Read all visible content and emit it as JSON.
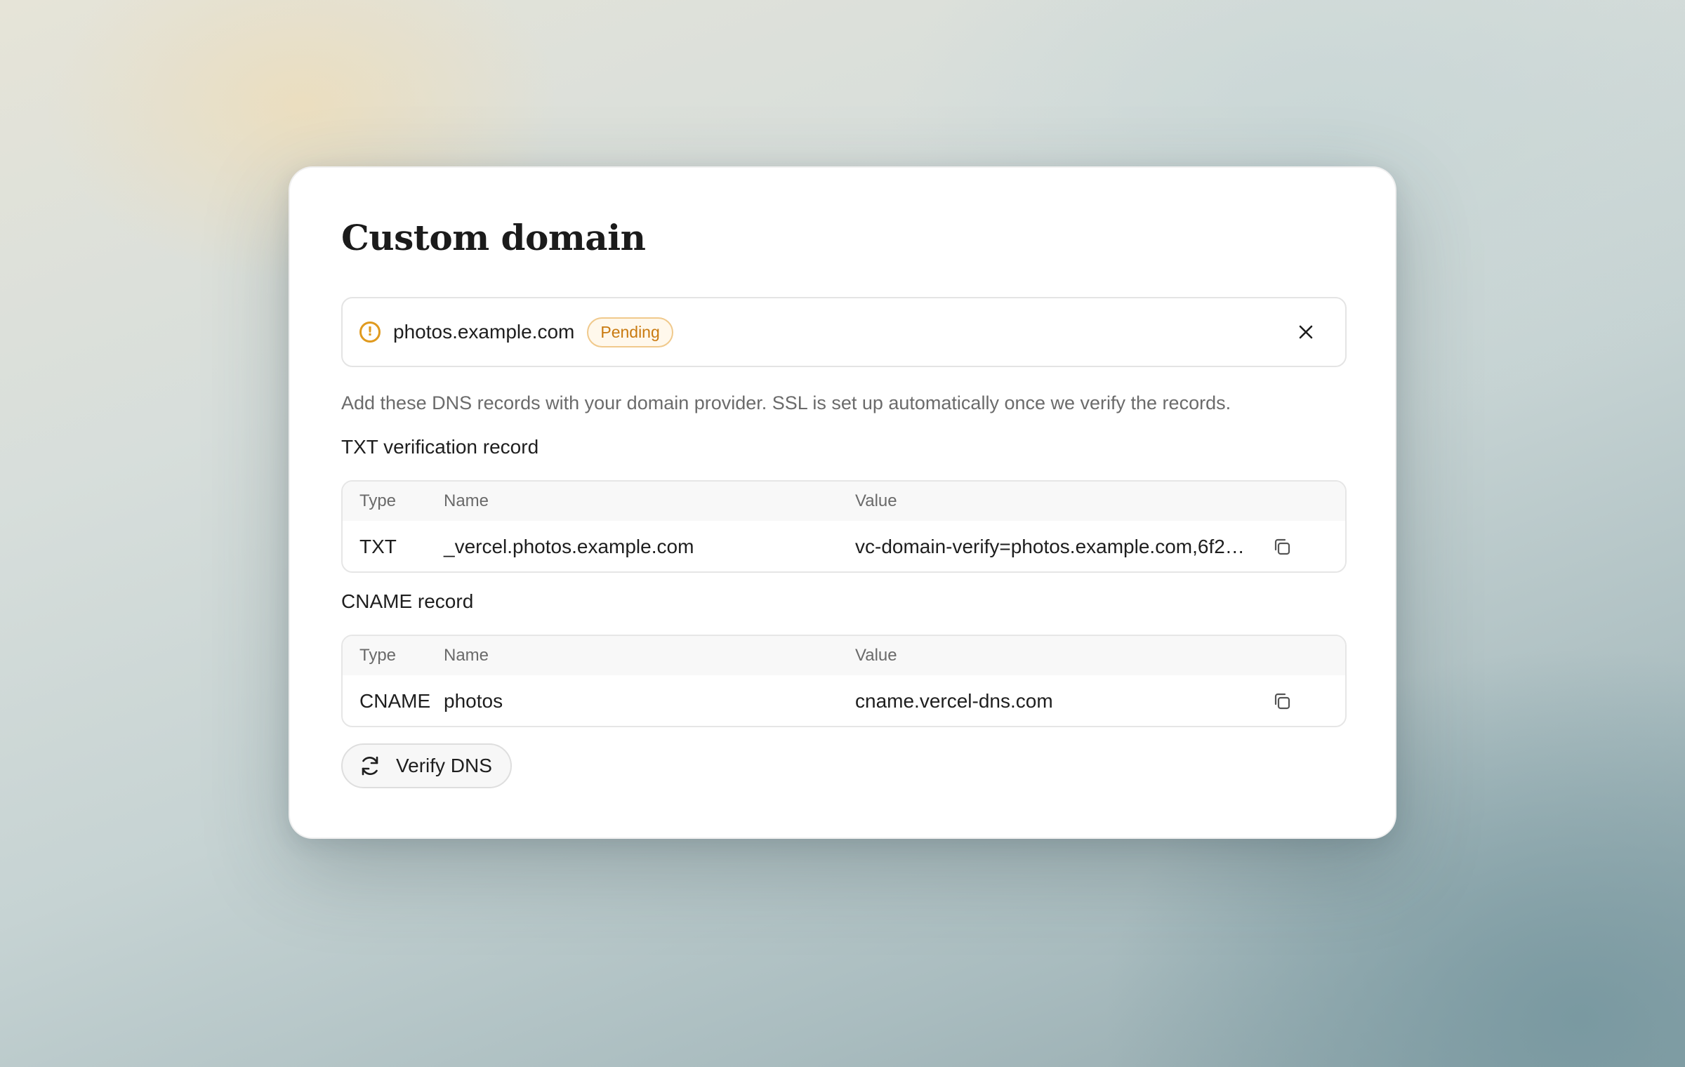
{
  "dialog": {
    "title": "Custom domain"
  },
  "domain": {
    "name": "photos.example.com",
    "status": "Pending",
    "status_icon": "warning-circle-icon",
    "close_icon": "close-icon"
  },
  "description": "Add these DNS records with your domain provider. SSL is set up automatically once we verify the records.",
  "records": {
    "txt": {
      "label": "TXT verification record",
      "columns": [
        "Type",
        "Name",
        "Value"
      ],
      "type": "TXT",
      "name": "_vercel.photos.example.com",
      "value": "vc-domain-verify=photos.example.com,6f2…"
    },
    "cname": {
      "label": "CNAME record",
      "columns": [
        "Type",
        "Name",
        "Value"
      ],
      "type": "CNAME",
      "name": "photos",
      "value": "cname.vercel-dns.com"
    }
  },
  "verify_button": {
    "label": "Verify DNS",
    "icon": "refresh-icon"
  },
  "colors": {
    "pending_accent": "#e09a1e",
    "pending_text": "#c97a10"
  }
}
